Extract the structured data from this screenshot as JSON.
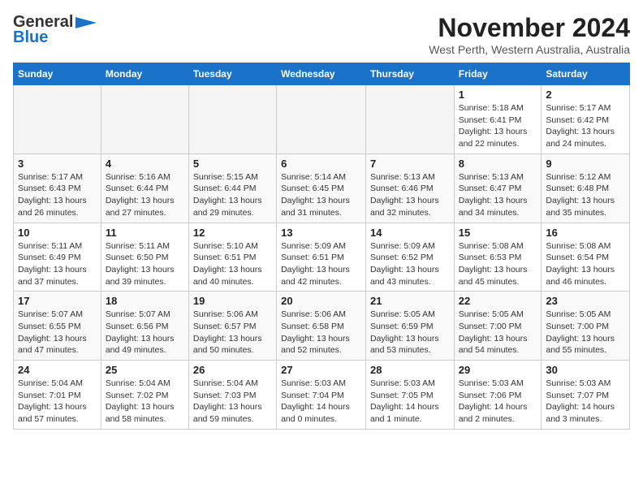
{
  "header": {
    "logo_line1": "General",
    "logo_line2": "Blue",
    "month": "November 2024",
    "location": "West Perth, Western Australia, Australia"
  },
  "weekdays": [
    "Sunday",
    "Monday",
    "Tuesday",
    "Wednesday",
    "Thursday",
    "Friday",
    "Saturday"
  ],
  "weeks": [
    [
      {
        "day": "",
        "info": ""
      },
      {
        "day": "",
        "info": ""
      },
      {
        "day": "",
        "info": ""
      },
      {
        "day": "",
        "info": ""
      },
      {
        "day": "",
        "info": ""
      },
      {
        "day": "1",
        "info": "Sunrise: 5:18 AM\nSunset: 6:41 PM\nDaylight: 13 hours\nand 22 minutes."
      },
      {
        "day": "2",
        "info": "Sunrise: 5:17 AM\nSunset: 6:42 PM\nDaylight: 13 hours\nand 24 minutes."
      }
    ],
    [
      {
        "day": "3",
        "info": "Sunrise: 5:17 AM\nSunset: 6:43 PM\nDaylight: 13 hours\nand 26 minutes."
      },
      {
        "day": "4",
        "info": "Sunrise: 5:16 AM\nSunset: 6:44 PM\nDaylight: 13 hours\nand 27 minutes."
      },
      {
        "day": "5",
        "info": "Sunrise: 5:15 AM\nSunset: 6:44 PM\nDaylight: 13 hours\nand 29 minutes."
      },
      {
        "day": "6",
        "info": "Sunrise: 5:14 AM\nSunset: 6:45 PM\nDaylight: 13 hours\nand 31 minutes."
      },
      {
        "day": "7",
        "info": "Sunrise: 5:13 AM\nSunset: 6:46 PM\nDaylight: 13 hours\nand 32 minutes."
      },
      {
        "day": "8",
        "info": "Sunrise: 5:13 AM\nSunset: 6:47 PM\nDaylight: 13 hours\nand 34 minutes."
      },
      {
        "day": "9",
        "info": "Sunrise: 5:12 AM\nSunset: 6:48 PM\nDaylight: 13 hours\nand 35 minutes."
      }
    ],
    [
      {
        "day": "10",
        "info": "Sunrise: 5:11 AM\nSunset: 6:49 PM\nDaylight: 13 hours\nand 37 minutes."
      },
      {
        "day": "11",
        "info": "Sunrise: 5:11 AM\nSunset: 6:50 PM\nDaylight: 13 hours\nand 39 minutes."
      },
      {
        "day": "12",
        "info": "Sunrise: 5:10 AM\nSunset: 6:51 PM\nDaylight: 13 hours\nand 40 minutes."
      },
      {
        "day": "13",
        "info": "Sunrise: 5:09 AM\nSunset: 6:51 PM\nDaylight: 13 hours\nand 42 minutes."
      },
      {
        "day": "14",
        "info": "Sunrise: 5:09 AM\nSunset: 6:52 PM\nDaylight: 13 hours\nand 43 minutes."
      },
      {
        "day": "15",
        "info": "Sunrise: 5:08 AM\nSunset: 6:53 PM\nDaylight: 13 hours\nand 45 minutes."
      },
      {
        "day": "16",
        "info": "Sunrise: 5:08 AM\nSunset: 6:54 PM\nDaylight: 13 hours\nand 46 minutes."
      }
    ],
    [
      {
        "day": "17",
        "info": "Sunrise: 5:07 AM\nSunset: 6:55 PM\nDaylight: 13 hours\nand 47 minutes."
      },
      {
        "day": "18",
        "info": "Sunrise: 5:07 AM\nSunset: 6:56 PM\nDaylight: 13 hours\nand 49 minutes."
      },
      {
        "day": "19",
        "info": "Sunrise: 5:06 AM\nSunset: 6:57 PM\nDaylight: 13 hours\nand 50 minutes."
      },
      {
        "day": "20",
        "info": "Sunrise: 5:06 AM\nSunset: 6:58 PM\nDaylight: 13 hours\nand 52 minutes."
      },
      {
        "day": "21",
        "info": "Sunrise: 5:05 AM\nSunset: 6:59 PM\nDaylight: 13 hours\nand 53 minutes."
      },
      {
        "day": "22",
        "info": "Sunrise: 5:05 AM\nSunset: 7:00 PM\nDaylight: 13 hours\nand 54 minutes."
      },
      {
        "day": "23",
        "info": "Sunrise: 5:05 AM\nSunset: 7:00 PM\nDaylight: 13 hours\nand 55 minutes."
      }
    ],
    [
      {
        "day": "24",
        "info": "Sunrise: 5:04 AM\nSunset: 7:01 PM\nDaylight: 13 hours\nand 57 minutes."
      },
      {
        "day": "25",
        "info": "Sunrise: 5:04 AM\nSunset: 7:02 PM\nDaylight: 13 hours\nand 58 minutes."
      },
      {
        "day": "26",
        "info": "Sunrise: 5:04 AM\nSunset: 7:03 PM\nDaylight: 13 hours\nand 59 minutes."
      },
      {
        "day": "27",
        "info": "Sunrise: 5:03 AM\nSunset: 7:04 PM\nDaylight: 14 hours\nand 0 minutes."
      },
      {
        "day": "28",
        "info": "Sunrise: 5:03 AM\nSunset: 7:05 PM\nDaylight: 14 hours\nand 1 minute."
      },
      {
        "day": "29",
        "info": "Sunrise: 5:03 AM\nSunset: 7:06 PM\nDaylight: 14 hours\nand 2 minutes."
      },
      {
        "day": "30",
        "info": "Sunrise: 5:03 AM\nSunset: 7:07 PM\nDaylight: 14 hours\nand 3 minutes."
      }
    ]
  ]
}
